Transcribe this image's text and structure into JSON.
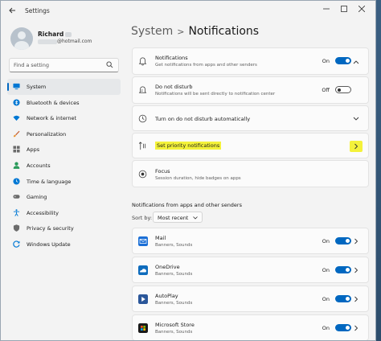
{
  "window": {
    "app_title": "Settings"
  },
  "user": {
    "name": "Richard",
    "email": "@hotmail.com"
  },
  "search": {
    "placeholder": "Find a setting"
  },
  "nav": [
    {
      "label": "System",
      "icon": "monitor-icon",
      "active": true
    },
    {
      "label": "Bluetooth & devices",
      "icon": "bluetooth-icon"
    },
    {
      "label": "Network & internet",
      "icon": "wifi-icon"
    },
    {
      "label": "Personalization",
      "icon": "brush-icon"
    },
    {
      "label": "Apps",
      "icon": "apps-icon"
    },
    {
      "label": "Accounts",
      "icon": "person-icon"
    },
    {
      "label": "Time & language",
      "icon": "globe-clock-icon"
    },
    {
      "label": "Gaming",
      "icon": "gamepad-icon"
    },
    {
      "label": "Accessibility",
      "icon": "accessibility-icon"
    },
    {
      "label": "Privacy & security",
      "icon": "shield-icon"
    },
    {
      "label": "Windows Update",
      "icon": "update-icon"
    }
  ],
  "breadcrumb": {
    "parent": "System",
    "separator": ">",
    "current": "Notifications"
  },
  "settings": {
    "notifications": {
      "title": "Notifications",
      "subtitle": "Get notifications from apps and other senders",
      "state": "On"
    },
    "dnd": {
      "title": "Do not disturb",
      "subtitle": "Notifications will be sent directly to notification center",
      "state": "Off"
    },
    "auto_dnd": {
      "title": "Turn on do not disturb automatically"
    },
    "priority": {
      "title": "Set priority notifications"
    },
    "focus": {
      "title": "Focus",
      "subtitle": "Session duration, hide badges on apps"
    }
  },
  "apps_section": {
    "title": "Notifications from apps and other senders",
    "sort_label": "Sort by:",
    "sort_value": "Most recent",
    "apps": [
      {
        "name": "Mail",
        "detail": "Banners, Sounds",
        "state": "On",
        "color": "#1b6fd6"
      },
      {
        "name": "OneDrive",
        "detail": "Banners, Sounds",
        "state": "On",
        "color": "#0f6cbd"
      },
      {
        "name": "AutoPlay",
        "detail": "Banners, Sounds",
        "state": "On",
        "color": "#2b579a"
      },
      {
        "name": "Microsoft Store",
        "detail": "Banners, Sounds",
        "state": "On",
        "color": "#1a1a1a"
      }
    ]
  },
  "colors": {
    "accent": "#0067c0",
    "highlight": "#f4f23a"
  }
}
